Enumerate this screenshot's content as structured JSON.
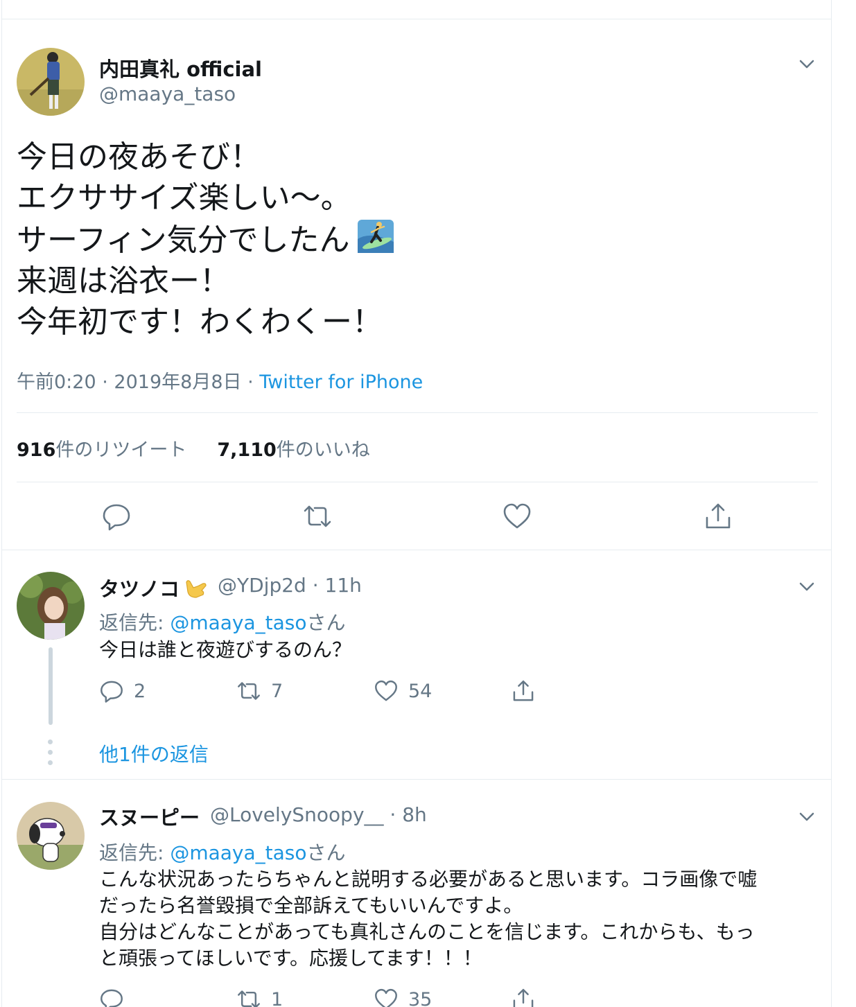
{
  "main_tweet": {
    "display_name": "内田真礼 official",
    "handle": "@maaya_taso",
    "text_lines": [
      "今日の夜あそび！",
      "エクササイズ楽しい〜。",
      "サーフィン気分でしたん",
      "来週は浴衣ー！",
      "今年初です！わくわくー！"
    ],
    "inline_emoji": "surfer-emoji",
    "time": "午前0:20",
    "date": "2019年8月8日",
    "separator": "·",
    "source": "Twitter for iPhone",
    "retweet_count": "916",
    "retweet_label": "件のリツイート",
    "like_count": "7,110",
    "like_label": "件のいいね",
    "actions": [
      "reply-icon",
      "retweet-icon",
      "like-icon",
      "share-icon"
    ]
  },
  "replies": [
    {
      "display_name": "タツノコ",
      "name_emoji": "call-me-hand-emoji",
      "handle": "@YDjp2d",
      "separator": "·",
      "time": "11h",
      "reply_to_prefix": "返信先: ",
      "reply_to_mention": "@maaya_taso",
      "reply_to_suffix": "さん",
      "text_lines": [
        "今日は誰と夜遊びするのん？"
      ],
      "reply_count": "2",
      "retweet_count": "7",
      "like_count": "54",
      "more_replies": "他1件の返信"
    },
    {
      "display_name": "スヌーピー",
      "handle": "@LovelySnoopy__",
      "separator": "·",
      "time": "8h",
      "reply_to_prefix": "返信先: ",
      "reply_to_mention": "@maaya_taso",
      "reply_to_suffix": "さん",
      "text_lines": [
        "こんな状況あったらちゃんと説明する必要があると思います。コラ画像で嘘",
        "だったら名誉毀損で全部訴えてもいいんですよ。",
        "自分はどんなことがあっても真礼さんのことを信じます。これからも、もっ",
        "と頑張ってほしいです。応援してます！！！"
      ],
      "reply_count": "",
      "retweet_count": "1",
      "like_count": "35"
    }
  ],
  "colors": {
    "text": "#14171a",
    "secondary": "#657786",
    "link": "#1b95e0",
    "border": "#e6ecf0"
  }
}
